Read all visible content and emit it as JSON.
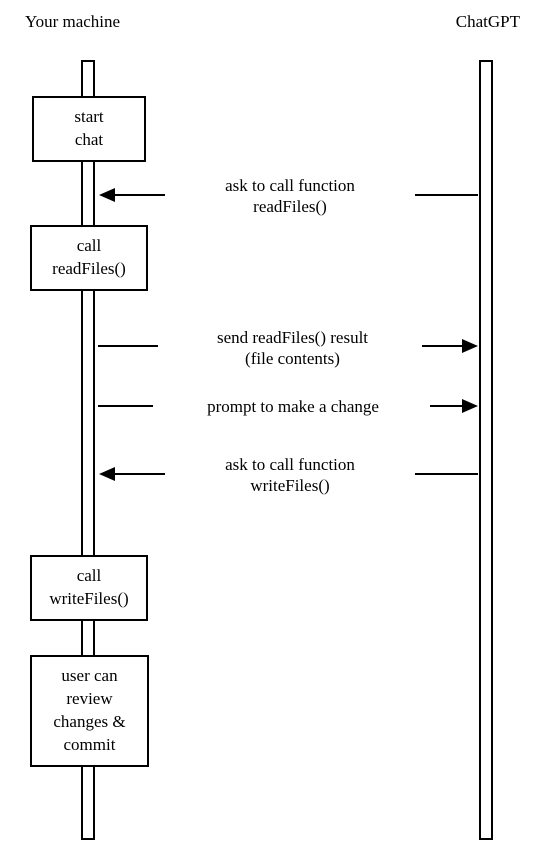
{
  "participants": {
    "left": "Your machine",
    "right": "ChatGPT"
  },
  "boxes": {
    "start_chat": "start\nchat",
    "call_readfiles": "call\nreadFiles()",
    "call_writefiles": "call\nwriteFiles()",
    "review": "user can\nreview\nchanges &\ncommit"
  },
  "messages": {
    "ask_readfiles": "ask to call function\nreadFiles()",
    "send_result": "send readFiles() result\n(file contents)",
    "prompt_change": "prompt to make a change",
    "ask_writefiles": "ask to call function\nwriteFiles()"
  }
}
